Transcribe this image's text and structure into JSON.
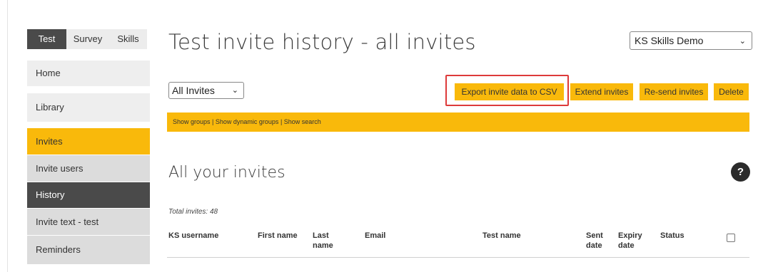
{
  "sidebar": {
    "tabs": [
      {
        "label": "Test",
        "active": true
      },
      {
        "label": "Survey",
        "active": false
      },
      {
        "label": "Skills",
        "active": false
      }
    ],
    "items": [
      {
        "label": "Home"
      },
      {
        "label": "Library"
      },
      {
        "label": "Invites",
        "highlighted": true
      },
      {
        "label": "Invite users"
      },
      {
        "label": "History",
        "selected": true
      },
      {
        "label": "Invite text - test"
      },
      {
        "label": "Reminders"
      }
    ]
  },
  "header": {
    "title": "Test invite history - all invites",
    "org_select": "KS Skills Demo"
  },
  "toolbar": {
    "filter_select": "All Invites",
    "export_label": "Export invite data to CSV",
    "extend_label": "Extend invites",
    "resend_label": "Re-send invites",
    "delete_label": "Delete"
  },
  "links_bar": {
    "show_groups": "Show groups",
    "show_dynamic_groups": "Show dynamic groups",
    "show_search": "Show search",
    "separator": " | "
  },
  "section": {
    "title": "All your invites",
    "help": "?",
    "total": "Total invites: 48"
  },
  "table": {
    "columns": [
      "KS username",
      "First name",
      "Last name",
      "Email",
      "Test name",
      "Sent date",
      "Expiry date",
      "Status"
    ]
  },
  "colors": {
    "accent": "#f9b90b",
    "dark": "#4a4a4a",
    "highlight_box": "#dd3a3a"
  },
  "icons": {
    "select_chevron": "chevron-down-icon",
    "help": "question-icon",
    "select_all": "checkbox-icon"
  }
}
